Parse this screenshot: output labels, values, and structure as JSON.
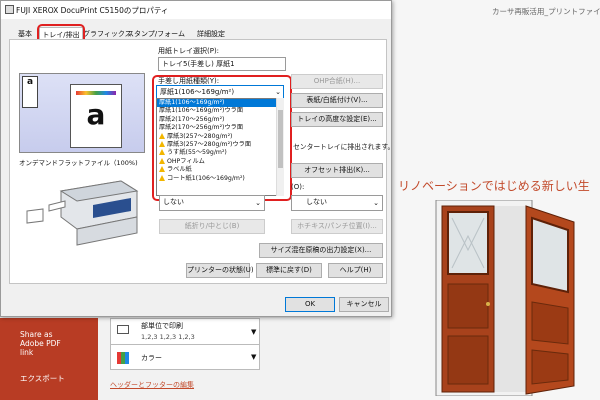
{
  "background": {
    "window_title": "カーサ再販活用_プリントファイル.pdf",
    "heading": "リノベーションではじめる新しい生",
    "sidebar": {
      "items": [
        "Share as",
        "Adobe PDF",
        "link",
        "エクスポート"
      ]
    },
    "print_option_1": {
      "label": "部単位で印刷",
      "sub": "1,2,3   1,2,3   1,2,3"
    },
    "print_option_2": {
      "label": "カラー"
    },
    "header_footer_link": "ヘッダーとフッターの編集"
  },
  "dialog": {
    "title": "FUJI XEROX DocuPrint C5150のプロパティ",
    "tabs": [
      "基本",
      "トレイ/排出",
      "グラフィックス",
      "スタンプ/フォーム",
      "詳細設定"
    ],
    "active_tab": "トレイ/排出",
    "paper_tray_label": "用紙トレイ選択(P):",
    "paper_tray_value": "トレイ5(手差し)          厚紙1",
    "manual_paper_label": "手差し用紙種類(Y):",
    "manual_paper_value": "厚紙1(106～169g/m²)",
    "paper_name": "オンデマンドフラットファイル（100%)",
    "buttons": {
      "ohp": "OHP合紙(H)...",
      "cover": "表紙/白紙付け(V)...",
      "tray_priority": "トレイの高度な設定(E)...",
      "offset": "オフセット排出(K)...",
      "fold": "紙折り/中とじ(B)",
      "hole": "ホチキス/パンチ位置(I)...",
      "mixed_size": "サイズ混在原稿の出力設定(X)...",
      "printer_status": "プリンターの状態(U)",
      "restore_defaults": "標準に戻す(D)",
      "help": "ヘルプ(H)",
      "ok": "OK",
      "cancel": "キャンセル"
    },
    "center_tray_text": "センタートレイに排出されます。",
    "output_label": "(O):",
    "lower_combo_1": "しない",
    "lower_combo_2": "しない",
    "paper_types": [
      {
        "label": "厚紙1(106～169g/m²)",
        "warn": false,
        "selected": true
      },
      {
        "label": "厚紙1(106～169g/m²)ウラ面",
        "warn": false
      },
      {
        "label": "厚紙2(170～256g/m²)",
        "warn": false
      },
      {
        "label": "厚紙2(170～256g/m²)ウラ面",
        "warn": false
      },
      {
        "label": "厚紙3(257～280g/m²)",
        "warn": true
      },
      {
        "label": "厚紙3(257～280g/m²)ウラ面",
        "warn": true
      },
      {
        "label": "うす紙(55～59g/m²)",
        "warn": true
      },
      {
        "label": "OHPフィルム",
        "warn": true
      },
      {
        "label": "ラベル紙",
        "warn": true
      },
      {
        "label": "コート紙1(106～169g/m²)",
        "warn": true
      }
    ]
  },
  "colors": {
    "accent": "#0078d7",
    "highlight": "#e02020",
    "brand_bg": "#b83c24"
  }
}
